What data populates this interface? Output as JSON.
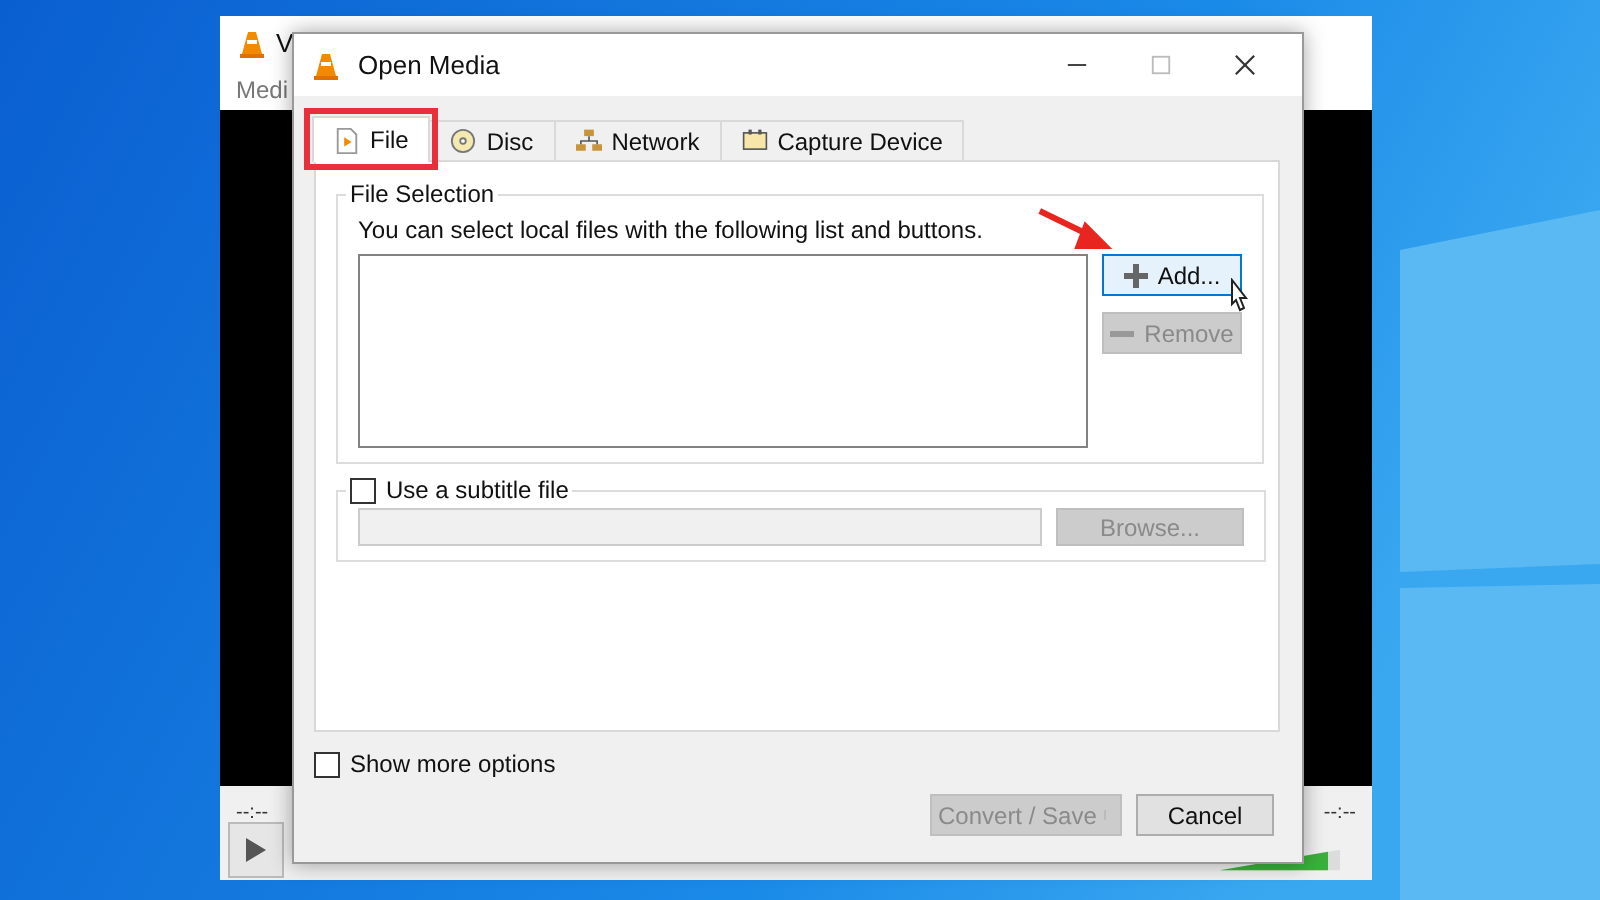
{
  "background_window": {
    "title": "V",
    "menu": "Medi",
    "time_elapsed": "--:--",
    "time_total": "--:--",
    "volume": {
      "level": 0.9
    }
  },
  "dialog": {
    "title": "Open Media",
    "tabs": [
      {
        "label": "File",
        "kind": "file",
        "selected": true,
        "highlighted": true
      },
      {
        "label": "Disc",
        "kind": "disc",
        "selected": false,
        "highlighted": false
      },
      {
        "label": "Network",
        "kind": "network",
        "selected": false,
        "highlighted": false
      },
      {
        "label": "Capture Device",
        "kind": "capture",
        "selected": false,
        "highlighted": false
      }
    ],
    "file_selection": {
      "legend": "File Selection",
      "hint": "You can select local files with the following list and buttons.",
      "buttons": [
        {
          "label": "Add...",
          "kind": "add",
          "disabled": false,
          "hovered": true,
          "pointed": true
        },
        {
          "label": "Remove",
          "kind": "remove",
          "disabled": true,
          "hovered": false,
          "pointed": false
        }
      ]
    },
    "subtitle": {
      "label": "Use a subtitle file",
      "checked": false,
      "browse": {
        "label": "Browse...",
        "disabled": true
      }
    },
    "show_more_options": {
      "label": "Show more options",
      "checked": false
    },
    "buttons": [
      {
        "label": "Convert / Save",
        "disabled": true,
        "dropdown": true
      },
      {
        "label": "Cancel",
        "disabled": false,
        "dropdown": false
      }
    ]
  }
}
